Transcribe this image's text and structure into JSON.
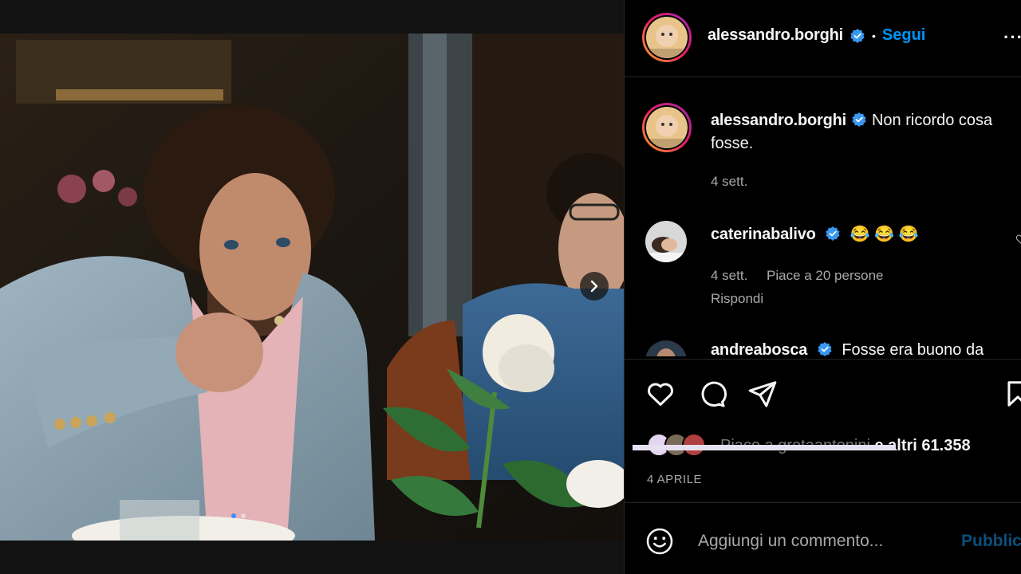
{
  "post": {
    "username": "alessandro.borghi",
    "follow_label": "Segui",
    "more_label": "···",
    "separator": "•"
  },
  "caption": {
    "username": "alessandro.borghi",
    "text": "Non ricordo cosa fosse.",
    "time": "4 sett."
  },
  "comments": [
    {
      "username": "caterinabalivo",
      "text": "😂 😂 😂",
      "time": "4 sett.",
      "likes": "Piace a 20 persone",
      "reply": "Rispondi"
    },
    {
      "username": "andreabosca",
      "text": "Fosse era buono da"
    }
  ],
  "likes": {
    "prefix": "Piace a gretaantonini",
    "suffix": "e altri 61.358"
  },
  "date": "4 APRILE",
  "add_comment": {
    "placeholder": "Aggiungi un commento...",
    "publish_label": "Pubblica"
  },
  "icons": {
    "like": "heart-icon",
    "comment": "comment-icon",
    "share": "paper-plane-icon",
    "save": "bookmark-icon",
    "emoji": "emoji-icon",
    "verified": "verified-badge-icon",
    "next": "chevron-right-icon"
  },
  "colors": {
    "accent": "#0095f6",
    "verified": "#3897f0",
    "background": "#000000",
    "secondary_text": "#a8a8a8"
  },
  "carousel": {
    "slides": 2,
    "active": 1
  }
}
